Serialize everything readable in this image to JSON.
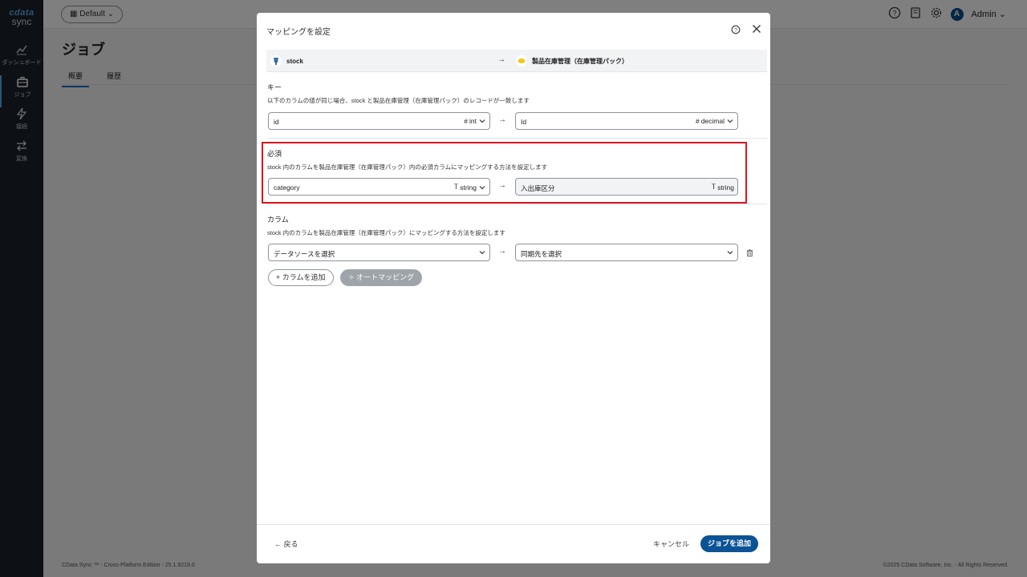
{
  "sidebar": {
    "logo_top": "cdata",
    "logo_bottom": "sync",
    "items": [
      {
        "label": "ダッシュボード"
      },
      {
        "label": "ジョブ"
      },
      {
        "label": "接続"
      },
      {
        "label": "変換"
      }
    ]
  },
  "header": {
    "workspace": "Default",
    "user": "Admin",
    "avatar_letter": "A"
  },
  "page": {
    "title": "ジョブ",
    "tabs": [
      "概要",
      "履歴"
    ]
  },
  "footer": {
    "left": "CData Sync ™ - Cross-Platform Edition - 25.1.9219.0",
    "right": "©2025 CData Software, Inc. - All Rights Reserved."
  },
  "modal": {
    "title": "マッピングを設定",
    "source": "stock",
    "destination": "製品在庫管理（在庫管理パック）",
    "key": {
      "title": "キー",
      "desc": "以下のカラムの値が同じ場合、stock と製品在庫管理（在庫管理パック）のレコードが一致します",
      "src_value": "id",
      "src_type": "int",
      "dst_value": "Id",
      "dst_type": "decimal"
    },
    "required": {
      "title": "必須",
      "desc": "stock 内のカラムを製品在庫管理（在庫管理パック）内の必須カラムにマッピングする方法を設定します",
      "src_value": "category",
      "src_type": "string",
      "dst_value": "入出庫区分",
      "dst_type": "string"
    },
    "columns": {
      "title": "カラム",
      "desc": "stock 内のカラムを製品在庫管理（在庫管理パック）にマッピングする方法を設定します",
      "src_placeholder": "データソースを選択",
      "dst_placeholder": "同期先を選択"
    },
    "add_column": "カラムを追加",
    "auto_mapping": "オートマッピング",
    "back": "戻る",
    "cancel": "キャンセル",
    "add_job": "ジョブを追加"
  },
  "colors": {
    "primary": "#0b5394",
    "highlight": "#e0141e",
    "sidebar": "#1b2129"
  }
}
